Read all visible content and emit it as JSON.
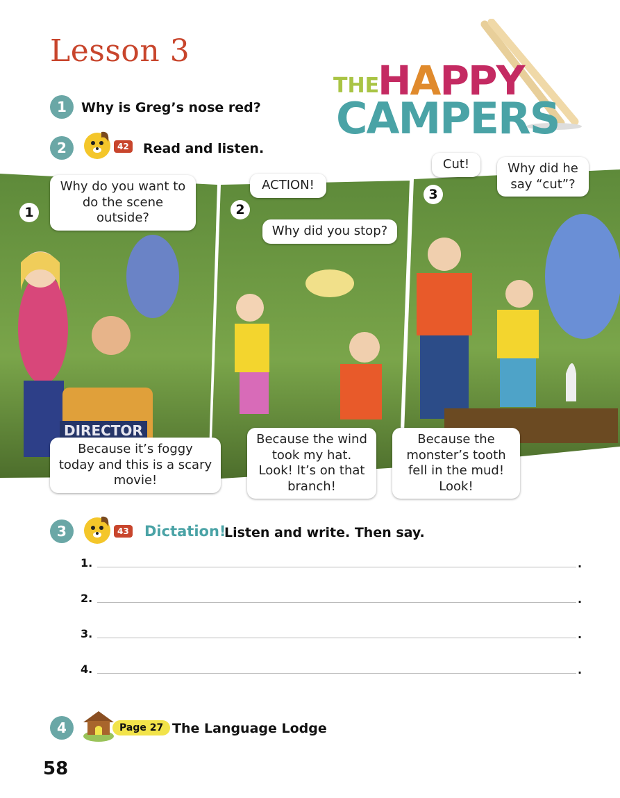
{
  "lesson_title": "Lesson 3",
  "logo": {
    "the": "THE",
    "happy": "HAPPY",
    "campers": "CAMPERS"
  },
  "exercises": [
    {
      "number": "1",
      "text": "Why is Greg’s nose red?"
    },
    {
      "number": "2",
      "track": "42",
      "text": "Read and listen."
    },
    {
      "number": "3",
      "track": "43",
      "highlight": "Dictation!",
      "text": "Listen and write. Then say."
    },
    {
      "number": "4",
      "page_ref": "Page 27",
      "text": "The Language Lodge"
    }
  ],
  "comic": {
    "panels": [
      {
        "number": "1",
        "bubbles": [
          "Why do you want to do the scene outside?",
          "Because it’s foggy today and this is a scary movie!"
        ],
        "chair_label": "DIRECTOR"
      },
      {
        "number": "2",
        "bubbles": [
          "ACTION!",
          "Why did you stop?",
          "Because the wind took my hat. Look! It’s on that branch!"
        ]
      },
      {
        "number": "3",
        "bubbles": [
          "Cut!",
          "Why did he say “cut”?",
          "Because the monster’s tooth fell in the mud! Look!"
        ]
      }
    ]
  },
  "dictation_lines": [
    "1.",
    "2.",
    "3.",
    "4."
  ],
  "line_end": ".",
  "page_number": "58",
  "colors": {
    "accent_red": "#c8452c",
    "teal": "#6aa7a6",
    "logo_green": "#a9c444",
    "logo_magenta": "#c42a62",
    "logo_teal": "#4aa3a6",
    "lodge_yellow": "#f2e34a"
  }
}
